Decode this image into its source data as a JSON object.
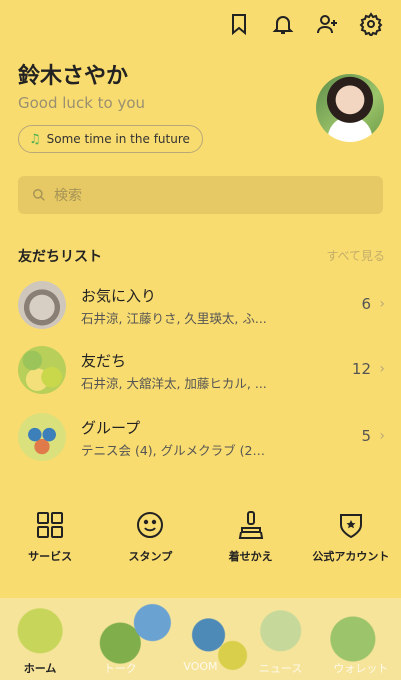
{
  "header": {
    "icons": [
      "bookmark-icon",
      "bell-icon",
      "add-friend-icon",
      "gear-icon"
    ]
  },
  "profile": {
    "name": "鈴木さやか",
    "status_message": "Good luck to you",
    "music": "Some time in the future"
  },
  "search": {
    "placeholder": "検索"
  },
  "friends_section": {
    "title": "友だちリスト",
    "see_all": "すべて見る",
    "items": [
      {
        "title": "お気に入り",
        "subtitle": "石井涼, 江藤りさ, 久里瑛太, ふ...",
        "count": "6"
      },
      {
        "title": "友だち",
        "subtitle": "石井涼, 大舘洋太, 加藤ヒカル, ...",
        "count": "12"
      },
      {
        "title": "グループ",
        "subtitle": "テニス会 (4), グルメクラブ (20)...",
        "count": "5"
      }
    ]
  },
  "services": [
    {
      "label": "サービス",
      "icon": "grid-icon"
    },
    {
      "label": "スタンプ",
      "icon": "smile-icon"
    },
    {
      "label": "着せかえ",
      "icon": "brush-icon"
    },
    {
      "label": "公式アカウント",
      "icon": "shield-star-icon"
    }
  ],
  "bottom_nav": {
    "items": [
      "ホーム",
      "トーク",
      "VOOM",
      "ニュース",
      "ウォレット"
    ],
    "active": "ホーム"
  }
}
